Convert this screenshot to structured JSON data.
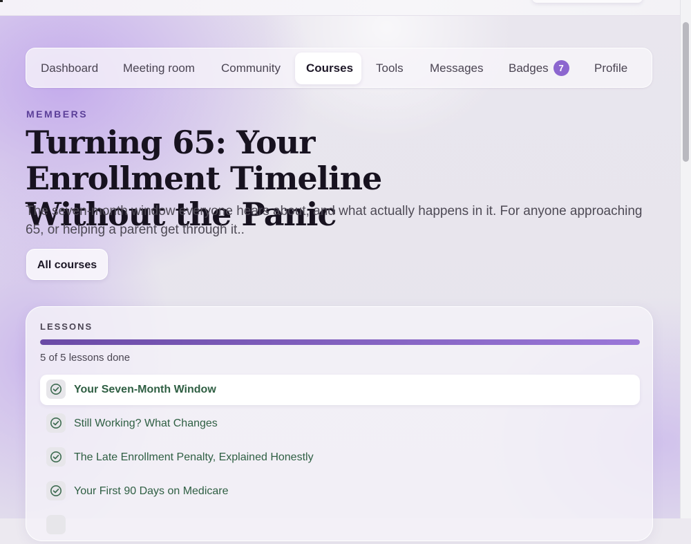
{
  "nav": {
    "items": [
      {
        "label": "Dashboard"
      },
      {
        "label": "Meeting room"
      },
      {
        "label": "Community"
      },
      {
        "label": "Courses"
      },
      {
        "label": "Tools"
      },
      {
        "label": "Messages"
      },
      {
        "label": "Badges",
        "badge": "7"
      },
      {
        "label": "Profile"
      }
    ],
    "active": "Courses"
  },
  "hero": {
    "eyebrow": "MEMBERS",
    "title": "Turning 65: Your Enrollment Timeline Without the Panic",
    "subtitle": "The seven-month window everyone hears about, and what actually happens in it. For anyone approaching 65, or helping a parent get through it..",
    "all_courses_label": "All courses"
  },
  "lessons": {
    "label": "LESSONS",
    "progress_text": "5 of 5 lessons done",
    "progress_fraction": 1.0,
    "items": [
      {
        "title": "Your Seven-Month Window",
        "done": true,
        "current": true
      },
      {
        "title": "Still Working? What Changes",
        "done": true,
        "current": false
      },
      {
        "title": "The Late Enrollment Penalty, Explained Honestly",
        "done": true,
        "current": false
      },
      {
        "title": "Your First 90 Days on Medicare",
        "done": true,
        "current": false
      }
    ]
  },
  "colors": {
    "accent": "#5b3f98",
    "badge": "#8c66cf",
    "lesson_text": "#2f5f43",
    "check_icon": "#3d6b50"
  },
  "icons": {
    "lesson_status": "check-circle-icon"
  }
}
